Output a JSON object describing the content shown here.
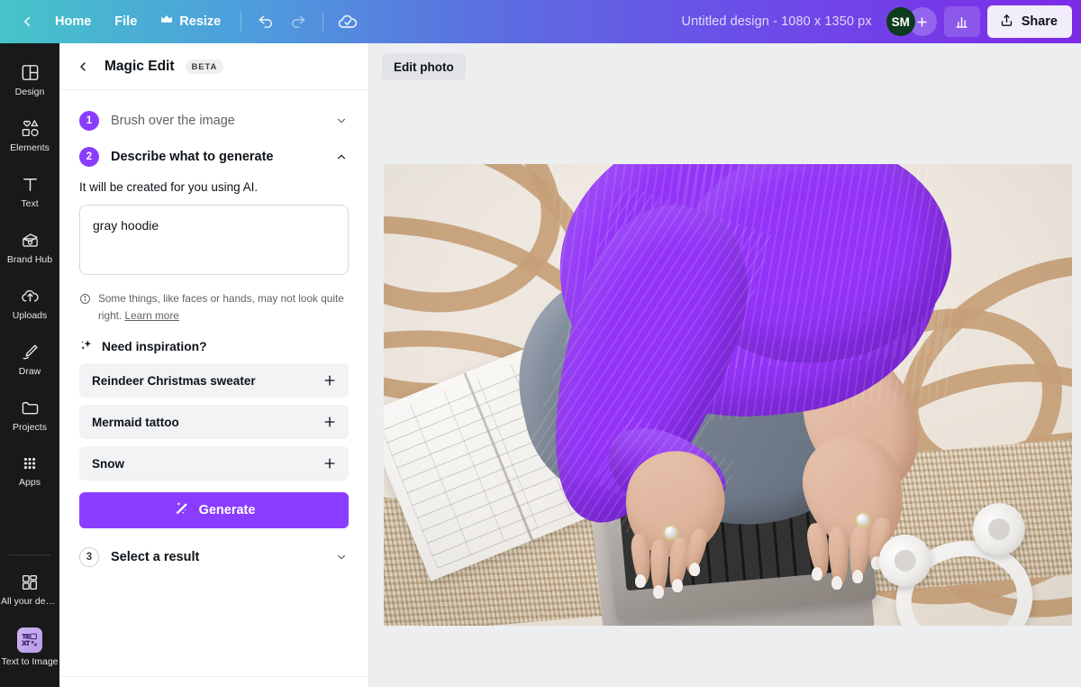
{
  "topbar": {
    "back_label": "",
    "home_label": "Home",
    "file_label": "File",
    "resize_label": "Resize",
    "undo_label": "",
    "redo_label": "",
    "cloud_label": "",
    "design_title": "Untitled design - 1080 x 1350 px",
    "avatar_initials": "SM",
    "avatar_color": "#0D3B1E",
    "add_member_label": "+",
    "share_label": "Share",
    "gradient_start": "#45C4C9",
    "gradient_end": "#7D2AE8"
  },
  "rail": {
    "items": [
      {
        "label": "Design",
        "icon": "design-icon"
      },
      {
        "label": "Elements",
        "icon": "elements-icon"
      },
      {
        "label": "Text",
        "icon": "text-icon"
      },
      {
        "label": "Brand Hub",
        "icon": "brand-hub-icon"
      },
      {
        "label": "Uploads",
        "icon": "uploads-icon"
      },
      {
        "label": "Draw",
        "icon": "draw-icon"
      },
      {
        "label": "Projects",
        "icon": "projects-icon"
      },
      {
        "label": "Apps",
        "icon": "apps-icon"
      }
    ],
    "bottom_items": [
      {
        "label": "All your desi...",
        "icon": "all-designs-icon"
      },
      {
        "label": "Text to Image",
        "icon": "text-to-image-icon"
      }
    ]
  },
  "panel": {
    "title": "Magic Edit",
    "badge": "BETA",
    "step1": {
      "number": "1",
      "title": "Brush over the image"
    },
    "step2": {
      "number": "2",
      "title": "Describe what to generate",
      "helper": "It will be created for you using AI.",
      "prompt_value": "gray hoodie",
      "prompt_placeholder": "Describe what to generate",
      "disclaimer": "Some things, like faces or hands, may not look quite right.",
      "learn_more": "Learn more"
    },
    "inspiration": {
      "heading": "Need inspiration?",
      "suggestions": [
        "Reindeer Christmas sweater",
        "Mermaid tattoo",
        "Snow"
      ]
    },
    "generate_label": "Generate",
    "step3": {
      "number": "3",
      "title": "Select a result"
    },
    "accent_color": "#8B3DFF"
  },
  "canvas": {
    "edit_photo_label": "Edit photo",
    "background_color": "#EDEEF0",
    "selection_prompt_color": "#9333F7"
  }
}
